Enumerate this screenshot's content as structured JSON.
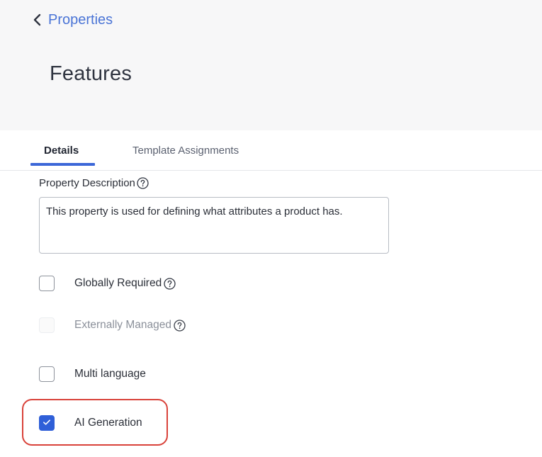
{
  "header": {
    "back_label": "Properties",
    "title": "Features"
  },
  "tabs": [
    {
      "label": "Details",
      "active": true
    },
    {
      "label": "Template Assignments",
      "active": false
    }
  ],
  "description": {
    "label": "Property Description",
    "value": "This property is used for defining what attributes a product has."
  },
  "options": [
    {
      "label": "Globally Required",
      "checked": false,
      "disabled": false,
      "help": true
    },
    {
      "label": "Externally Managed",
      "checked": false,
      "disabled": true,
      "help": true
    },
    {
      "label": "Multi language",
      "checked": false,
      "disabled": false,
      "help": false
    },
    {
      "label": "AI Generation",
      "checked": true,
      "disabled": false,
      "help": false
    }
  ],
  "colors": {
    "accent": "#2f5fd8",
    "link": "#4a74d6",
    "highlight": "#d9423a"
  }
}
